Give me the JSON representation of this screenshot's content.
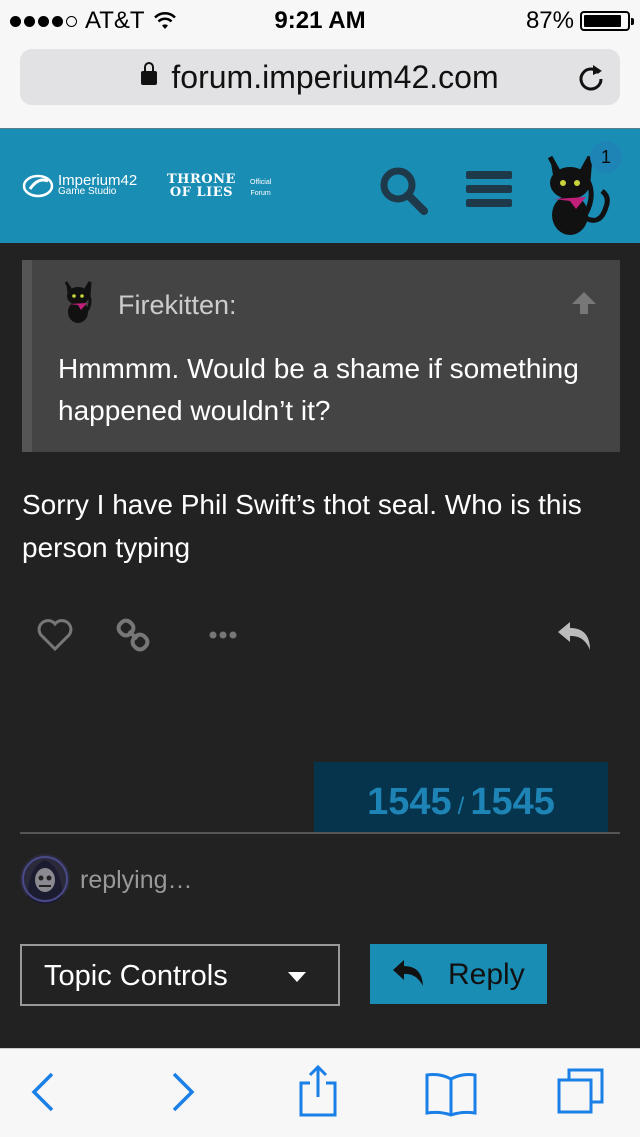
{
  "status_bar": {
    "carrier": "AT&T",
    "time": "9:21 AM",
    "battery": "87%",
    "battery_level": 0.87
  },
  "browser": {
    "url": "forum.imperium42.com"
  },
  "header": {
    "brand_name": "Imperium42",
    "brand_sub": "Game Studio",
    "game_line1": "THRONE",
    "game_line2": "OF LIES",
    "official_line1": "Official",
    "official_line2": "Forum",
    "notification_count": "1"
  },
  "quote": {
    "username": "Firekitten:",
    "text": "Hmmmm. Would be a shame if something happened wouldn’t it?"
  },
  "post": {
    "text": "Sorry I have Phil Swift’s thot seal. Who is this person typing"
  },
  "progress": {
    "current": "1545",
    "total": "1545",
    "separator": "/"
  },
  "composer": {
    "replying_text": "replying…",
    "topic_controls_label": "Topic Controls",
    "reply_label": "Reply"
  },
  "colors": {
    "accent": "#1a8db5",
    "background": "#222222",
    "quote_bg": "#444444",
    "progress_bg": "#06344d"
  }
}
